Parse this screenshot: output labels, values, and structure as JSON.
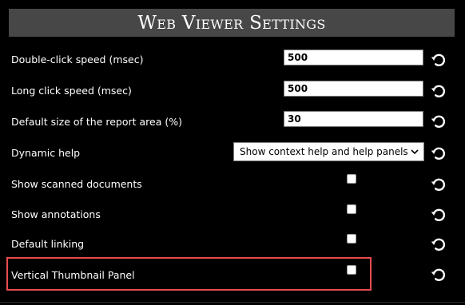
{
  "window": {
    "title": "Web Viewer Settings"
  },
  "settings": [
    {
      "label": "Double-click speed (msec)",
      "control": "text",
      "value": "500"
    },
    {
      "label": "Long click speed (msec)",
      "control": "text",
      "value": "500"
    },
    {
      "label": "Default size of the report area (%)",
      "control": "text",
      "value": "30"
    },
    {
      "label": "Dynamic help",
      "control": "select",
      "value": "Show context help and help panels"
    },
    {
      "label": "Show scanned documents",
      "control": "checkbox",
      "checked": false
    },
    {
      "label": "Show annotations",
      "control": "checkbox",
      "checked": false
    },
    {
      "label": "Default linking",
      "control": "checkbox",
      "checked": false
    },
    {
      "label": "Vertical Thumbnail Panel",
      "control": "checkbox",
      "checked": false,
      "highlighted": true
    }
  ],
  "icons": {
    "reset": "reset-icon",
    "dropdown": "chevron-down-icon"
  },
  "colors": {
    "background": "#000000",
    "title_bar": "#474747",
    "highlight_border": "#e84c4f"
  }
}
